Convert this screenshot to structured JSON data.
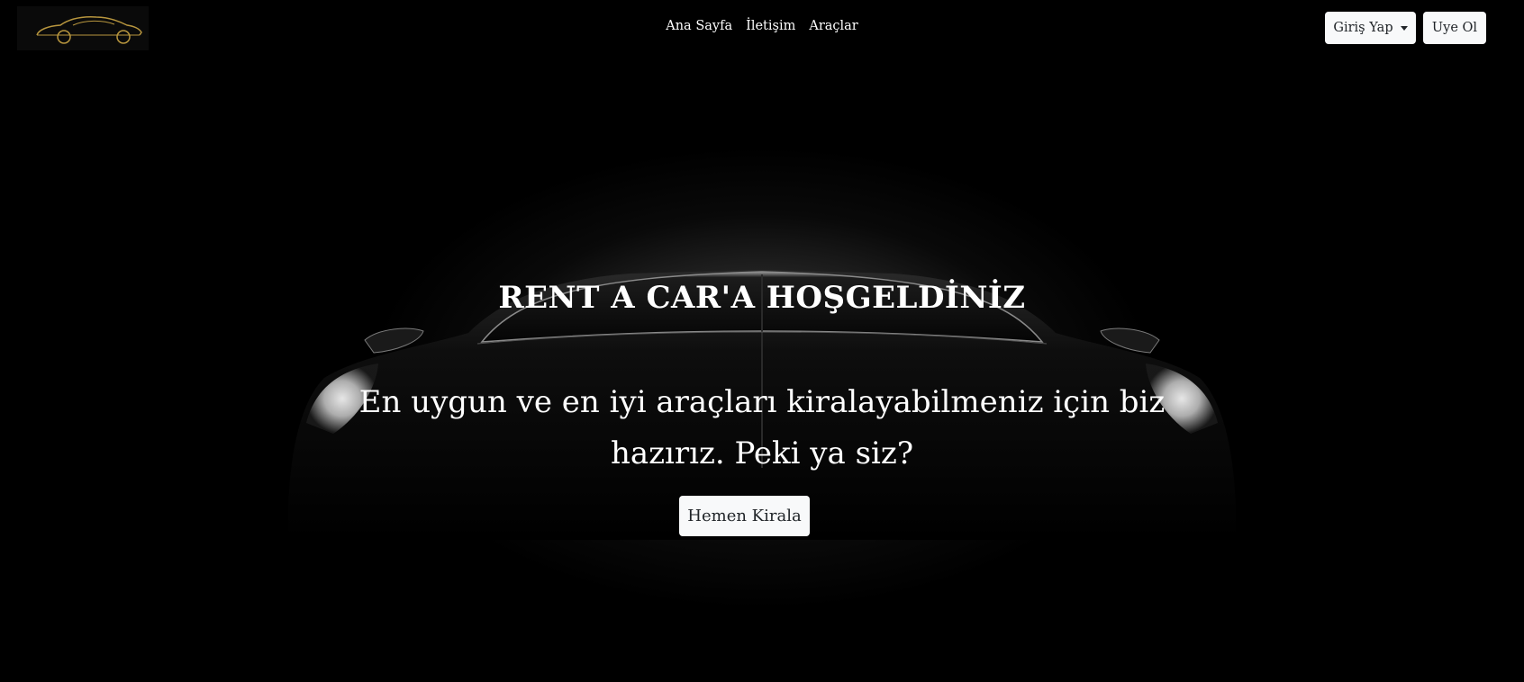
{
  "nav": {
    "links": [
      "Ana Sayfa",
      "İletişim",
      "Araçlar"
    ],
    "login_label": "Giriş Yap",
    "register_label": "Uye Ol"
  },
  "hero": {
    "title": "RENT A CAR'A HOŞGELDİNİZ",
    "subtitle": "En uygun ve en iyi araçları kiralayabilmeniz için biz hazırız. Peki ya siz?",
    "cta_label": "Hemen Kirala"
  },
  "colors": {
    "background": "#000000",
    "button_bg": "#f8f9fa",
    "button_text": "#212529",
    "logo_accent": "#b8963e"
  },
  "icons": {
    "logo": "car-outline-logo",
    "login_caret": "caret-down-icon"
  }
}
